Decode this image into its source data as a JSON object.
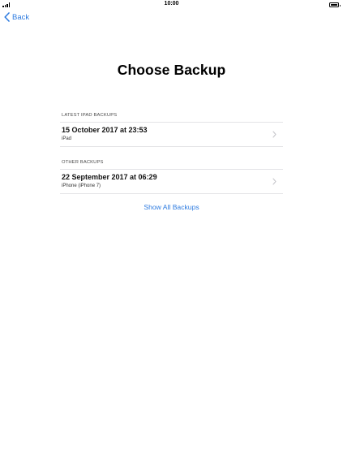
{
  "status_bar": {
    "time": "10:00"
  },
  "navigation": {
    "back_label": "Back"
  },
  "page": {
    "title": "Choose Backup"
  },
  "sections": [
    {
      "header": "LATEST IPAD BACKUPS",
      "items": [
        {
          "title": "15 October 2017 at 23:53",
          "subtitle": "iPad"
        }
      ]
    },
    {
      "header": "OTHER BACKUPS",
      "items": [
        {
          "title": "22 September 2017 at 06:29",
          "subtitle": "iPhone (iPhone 7)"
        }
      ]
    }
  ],
  "actions": {
    "show_all_label": "Show All Backups"
  },
  "colors": {
    "accent": "#2f7ce0",
    "divider": "#e3e3e6",
    "chevron": "#c7c7cc"
  }
}
